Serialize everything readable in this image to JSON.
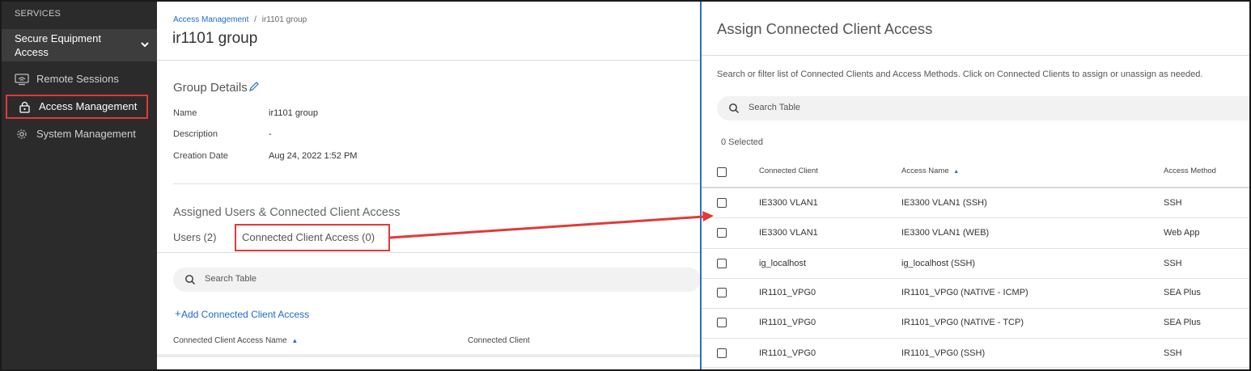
{
  "sidebar": {
    "section_title": "SERVICES",
    "group_label": "Secure Equipment Access",
    "items": [
      {
        "label": "Remote Sessions",
        "icon": "remote-sessions-icon"
      },
      {
        "label": "Access Management",
        "icon": "lock-icon"
      },
      {
        "label": "System Management",
        "icon": "gear-icon"
      }
    ]
  },
  "main": {
    "breadcrumb": {
      "parent": "Access Management",
      "separator": "/",
      "current": "ir1101 group"
    },
    "title": "ir1101 group",
    "group_details": {
      "title": "Group Details",
      "rows": [
        {
          "key": "Name",
          "value": "ir1101 group"
        },
        {
          "key": "Description",
          "value": "-"
        },
        {
          "key": "Creation Date",
          "value": "Aug 24, 2022 1:52 PM"
        }
      ]
    },
    "assigned_title": "Assigned Users & Connected Client Access",
    "tabs": [
      {
        "label": "Users (2)"
      },
      {
        "label": "Connected Client Access (0)"
      }
    ],
    "search_placeholder": "Search Table",
    "add_link": "Add Connected Client Access",
    "add_plus": "+",
    "table_headers": {
      "col1": "Connected Client Access Name",
      "col2": "Connected Client"
    }
  },
  "drawer": {
    "title": "Assign Connected Client Access",
    "description": "Search or filter list of Connected Clients and Access Methods. Click on Connected Clients to assign or unassign as needed.",
    "search_placeholder": "Search Table",
    "selected_text": "0 Selected",
    "headers": {
      "client": "Connected Client",
      "name": "Access Name",
      "method": "Access Method"
    },
    "rows": [
      {
        "client": "IE3300 VLAN1",
        "name": "IE3300 VLAN1 (SSH)",
        "method": "SSH"
      },
      {
        "client": "IE3300 VLAN1",
        "name": "IE3300 VLAN1 (WEB)",
        "method": "Web App"
      },
      {
        "client": "ig_localhost",
        "name": "ig_localhost (SSH)",
        "method": "SSH"
      },
      {
        "client": "IR1101_VPG0",
        "name": "IR1101_VPG0 (NATIVE - ICMP)",
        "method": "SEA Plus"
      },
      {
        "client": "IR1101_VPG0",
        "name": "IR1101_VPG0 (NATIVE - TCP)",
        "method": "SEA Plus"
      },
      {
        "client": "IR1101_VPG0",
        "name": "IR1101_VPG0 (SSH)",
        "method": "SSH"
      }
    ]
  },
  "colors": {
    "sidebar_bg": "#2b2b2b",
    "link": "#1d69cc",
    "highlight": "#e03a3a",
    "drawer_border": "#2d6fc4"
  }
}
